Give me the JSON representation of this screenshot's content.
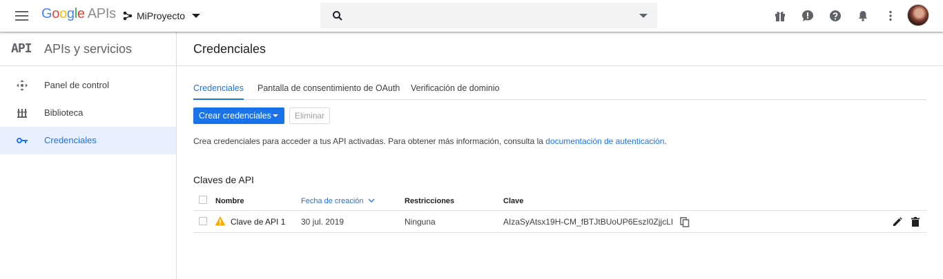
{
  "header": {
    "logo": {
      "G": "G",
      "o1": "o",
      "o2": "o",
      "g": "g",
      "l": "l",
      "e": "e",
      "apis": "APIs"
    },
    "project_name": "MiProyecto",
    "search_placeholder": ""
  },
  "sidebar": {
    "badge": "API",
    "title": "APIs y servicios",
    "items": [
      {
        "label": "Panel de control",
        "icon": "dashboard-icon"
      },
      {
        "label": "Biblioteca",
        "icon": "library-icon"
      },
      {
        "label": "Credenciales",
        "icon": "key-icon",
        "active": true
      }
    ]
  },
  "main": {
    "title": "Credenciales",
    "tabs": [
      {
        "label": "Credenciales",
        "active": true
      },
      {
        "label": "Pantalla de consentimiento de OAuth"
      },
      {
        "label": "Verificación de dominio"
      }
    ],
    "create_button": "Crear credenciales",
    "delete_button": "Eliminar",
    "info_text": "Crea credenciales para acceder a tus API activadas. Para obtener más información, consulta la ",
    "info_link": "documentación de autenticación",
    "info_suffix": ".",
    "api_keys": {
      "title": "Claves de API",
      "columns": {
        "name": "Nombre",
        "created": "Fecha de creación",
        "restrictions": "Restricciones",
        "key": "Clave"
      },
      "rows": [
        {
          "name": "Clave de API 1",
          "created": "30 jul. 2019",
          "restrictions": "Ninguna",
          "key": "AIzaSyAtsx19H-CM_fBTJtBUoUP6EszI0ZjjcLI"
        }
      ]
    }
  },
  "colors": {
    "accent": "#1a73e8",
    "warning": "#f9ab00",
    "active_bg": "#e8f0fe"
  }
}
